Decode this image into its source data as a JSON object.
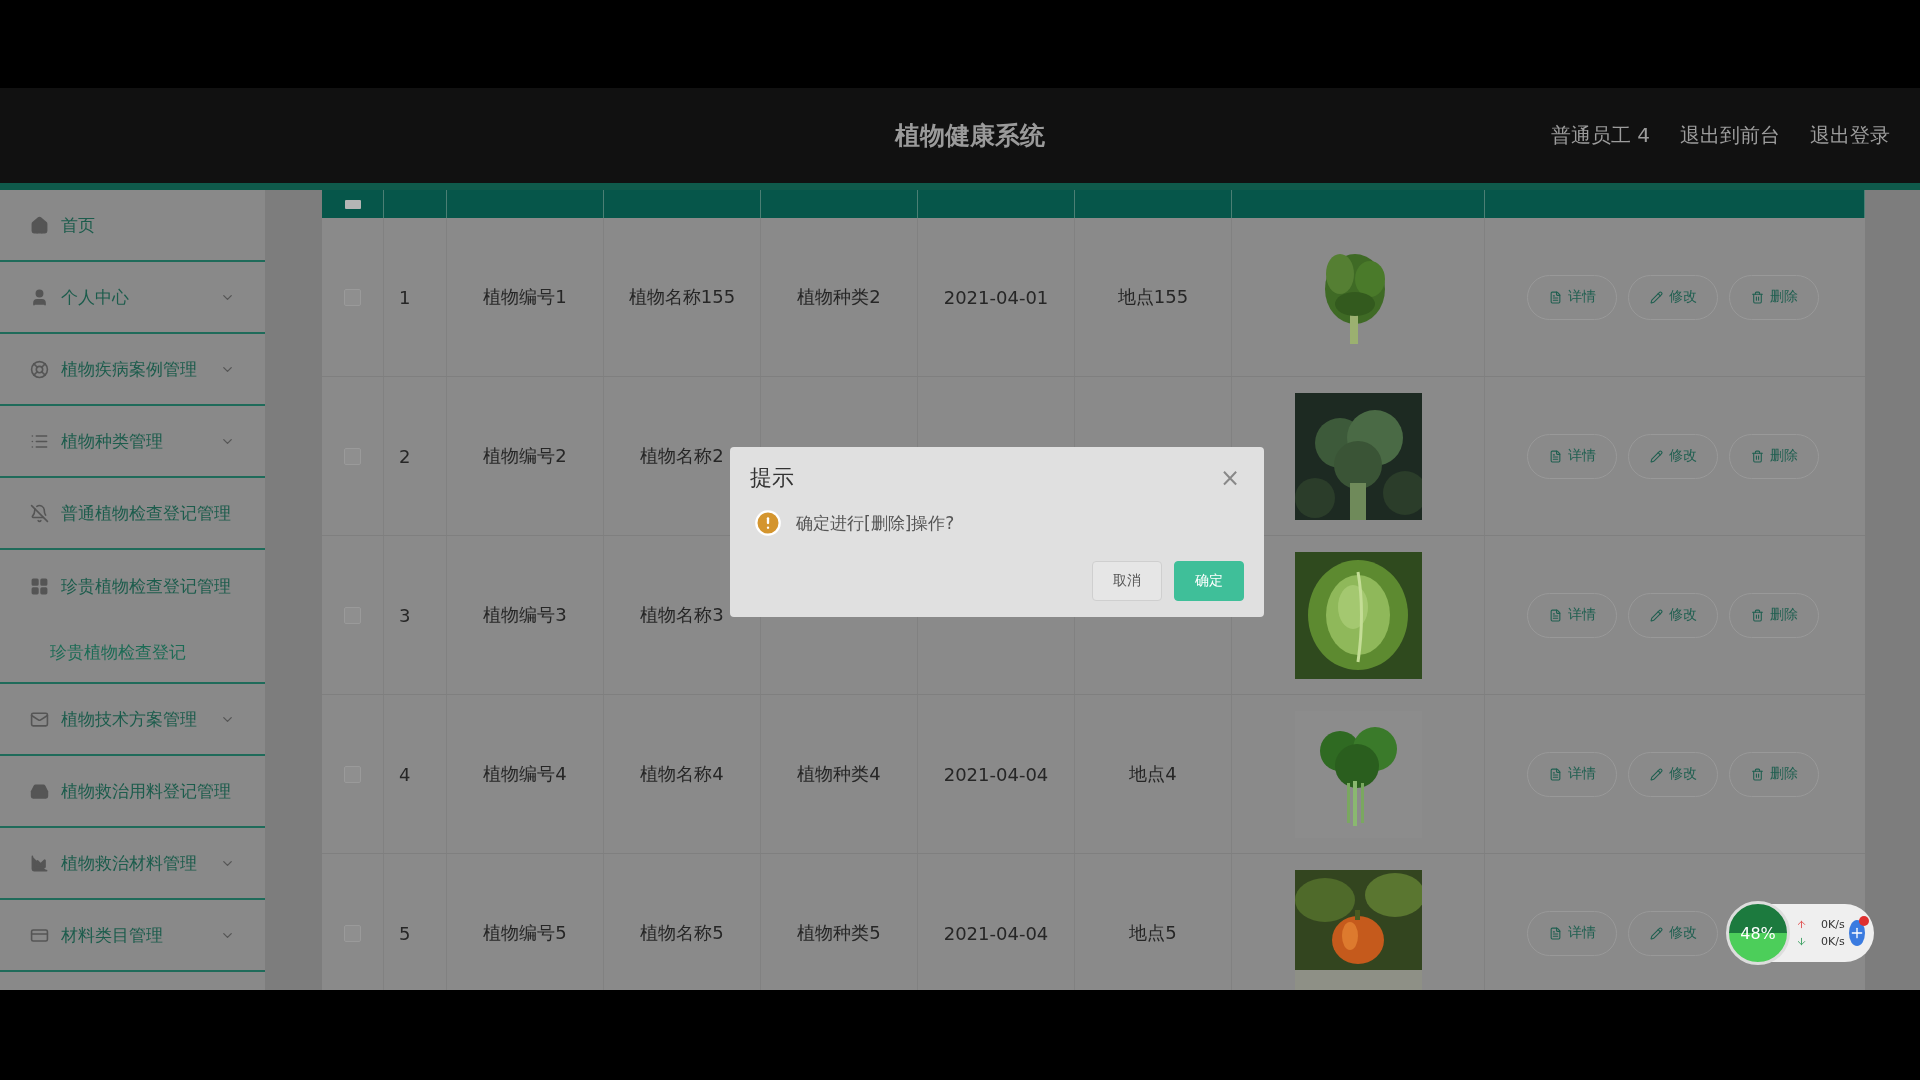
{
  "header": {
    "title": "植物健康系统",
    "user": "普通员工 4",
    "links": [
      "退出到前台",
      "退出登录"
    ]
  },
  "sidebar": {
    "items": [
      {
        "kind": "link",
        "label": "首页"
      },
      {
        "kind": "menu",
        "label": "个人中心",
        "expanded": false
      },
      {
        "kind": "menu",
        "label": "植物疾病案例管理",
        "expanded": false
      },
      {
        "kind": "menu",
        "label": "植物种类管理",
        "expanded": false
      },
      {
        "kind": "link",
        "label": "普通植物检查登记管理"
      },
      {
        "kind": "menu",
        "label": "珍贵植物检查登记管理",
        "expanded": true,
        "children": [
          {
            "label": "珍贵植物检查登记"
          }
        ]
      },
      {
        "kind": "menu",
        "label": "植物技术方案管理",
        "expanded": false
      },
      {
        "kind": "link",
        "label": "植物救治用料登记管理"
      },
      {
        "kind": "menu",
        "label": "植物救治材料管理",
        "expanded": false
      },
      {
        "kind": "menu",
        "label": "材料类目管理",
        "expanded": false
      }
    ]
  },
  "table": {
    "select_all_checked": false,
    "rows": [
      {
        "checked": false,
        "cells": [
          "1",
          "植物编号1",
          "植物名称155",
          "植物种类2",
          "2021-04-01",
          "地点155"
        ],
        "image": {
          "kind": "picture"
        },
        "actions": [
          "详情",
          "修改",
          "删除"
        ]
      },
      {
        "checked": false,
        "cells": [
          "2",
          "植物编号2",
          "植物名称2"
        ],
        "image": {
          "kind": "picture"
        },
        "actions": [
          "详情",
          "修改",
          "删除"
        ]
      },
      {
        "checked": false,
        "cells": [
          "3",
          "植物编号3",
          "植物名称3"
        ],
        "image": {
          "kind": "picture"
        },
        "actions": [
          "详情",
          "修改",
          "删除"
        ]
      },
      {
        "checked": false,
        "cells": [
          "4",
          "植物编号4",
          "植物名称4",
          "植物种类4",
          "2021-04-04",
          "地点4"
        ],
        "image": {
          "kind": "picture"
        },
        "actions": [
          "详情",
          "修改",
          "删除"
        ]
      },
      {
        "checked": false,
        "cells": [
          "5",
          "植物编号5",
          "植物名称5",
          "植物种类5",
          "2021-04-04",
          "地点5"
        ],
        "image": {
          "kind": "picture"
        },
        "actions": [
          "详情",
          "修改"
        ]
      }
    ]
  },
  "dialog": {
    "title": "提示",
    "close": "×",
    "message": "确定进行[删除]操作?",
    "buttons": [
      {
        "label": "取消",
        "primary": false
      },
      {
        "label": "确定",
        "primary": true
      }
    ]
  },
  "speed_widget": {
    "percent": "48%",
    "up": "0K/s",
    "down": "0K/s"
  }
}
